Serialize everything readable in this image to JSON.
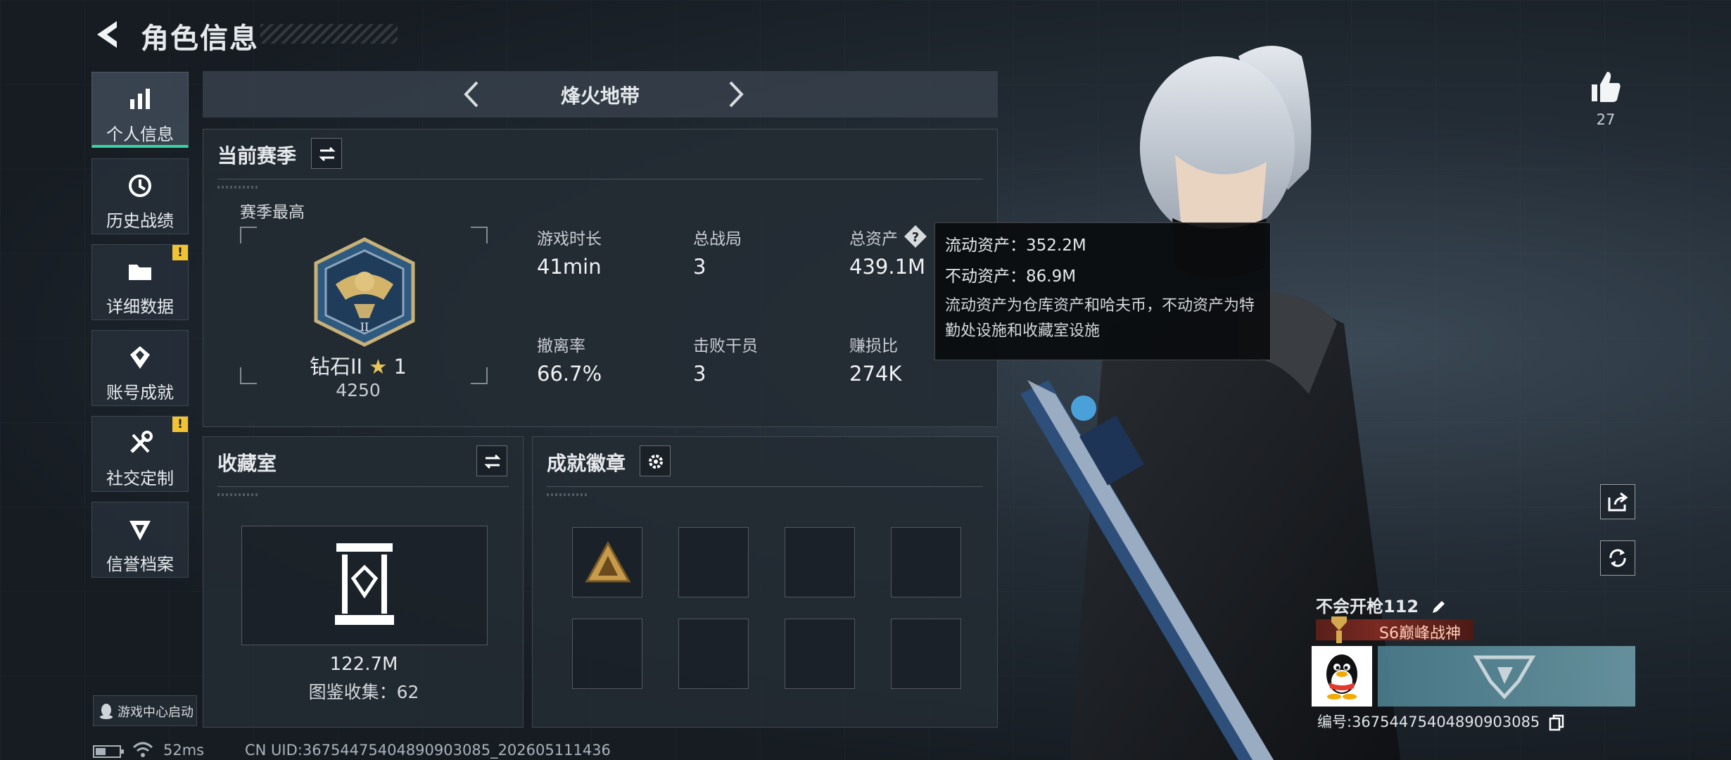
{
  "header": {
    "title": "角色信息"
  },
  "nav": {
    "items": [
      {
        "label": "个人信息",
        "icon": "bar-chart-icon",
        "active": true,
        "badge": ""
      },
      {
        "label": "历史战绩",
        "icon": "history-icon",
        "active": false,
        "badge": ""
      },
      {
        "label": "详细数据",
        "icon": "folder-icon",
        "active": false,
        "badge": "!"
      },
      {
        "label": "账号成就",
        "icon": "achievement-icon",
        "active": false,
        "badge": ""
      },
      {
        "label": "社交定制",
        "icon": "tools-icon",
        "active": false,
        "badge": "!"
      },
      {
        "label": "信誉档案",
        "icon": "credit-icon",
        "active": false,
        "badge": ""
      }
    ],
    "game_center_label": "游戏中心启动"
  },
  "mode": {
    "label": "烽火地带"
  },
  "season": {
    "title": "当前赛季",
    "best_label": "赛季最高",
    "rank_name": "钻石II",
    "rank_stars": "1",
    "rank_score": "4250",
    "stats": [
      {
        "label": "游戏时长",
        "value": "41min"
      },
      {
        "label": "总战局",
        "value": "3"
      },
      {
        "label": "总资产",
        "value": "439.1M"
      },
      {
        "label": "撤离率",
        "value": "66.7%"
      },
      {
        "label": "击败干员",
        "value": "3"
      },
      {
        "label": "赚损比",
        "value": "274K"
      }
    ]
  },
  "tooltip": {
    "liquid": "流动资产：352.2M",
    "fixed": "不动资产：86.9M",
    "note": "流动资产为仓库资产和哈夫币，不动资产为特勤处设施和收藏室设施"
  },
  "collection": {
    "title": "收藏室",
    "value": "122.7M",
    "catalog": "图鉴收集：62"
  },
  "badges": {
    "title": "成就徽章"
  },
  "player": {
    "likes": "27",
    "name": "不会开枪112",
    "title": "S6巅峰战神",
    "uid_label": "编号:36754475404890903085"
  },
  "status": {
    "ping": "52ms",
    "cn_uid": "CN UID:36754475404890903085_202605111436"
  },
  "colors": {
    "accent": "#38d39f",
    "warning": "#f1c232",
    "banner": "#7a2a22"
  }
}
